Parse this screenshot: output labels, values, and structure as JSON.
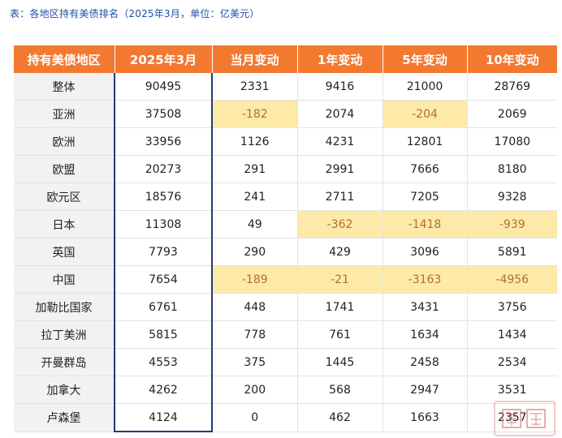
{
  "caption": "表：各地区持有美债排名（2025年3月，单位：亿美元）",
  "table": {
    "headers": [
      "持有美债地区",
      "2025年3月",
      "当月变动",
      "1年变动",
      "5年变动",
      "10年变动"
    ],
    "rows": [
      [
        "整体",
        "90495",
        "2331",
        "9416",
        "21000",
        "28769"
      ],
      [
        "亚洲",
        "37508",
        "-182",
        "2074",
        "-204",
        "2069"
      ],
      [
        "欧洲",
        "33956",
        "1126",
        "4231",
        "12801",
        "17080"
      ],
      [
        "欧盟",
        "20273",
        "291",
        "2991",
        "7666",
        "8180"
      ],
      [
        "欧元区",
        "18576",
        "241",
        "2711",
        "7205",
        "9328"
      ],
      [
        "日本",
        "11308",
        "49",
        "-362",
        "-1418",
        "-939"
      ],
      [
        "英国",
        "7793",
        "290",
        "429",
        "3096",
        "5891"
      ],
      [
        "中国",
        "7654",
        "-189",
        "-21",
        "-3163",
        "-4956"
      ],
      [
        "加勒比国家",
        "6761",
        "448",
        "1741",
        "3431",
        "3756"
      ],
      [
        "拉丁美洲",
        "5815",
        "778",
        "761",
        "1634",
        "1434"
      ],
      [
        "开曼群岛",
        "4553",
        "375",
        "1445",
        "2458",
        "2534"
      ],
      [
        "加拿大",
        "4262",
        "200",
        "568",
        "2947",
        "3531"
      ],
      [
        "卢森堡",
        "4124",
        "0",
        "462",
        "1663",
        "2357"
      ]
    ]
  },
  "colors": {
    "header_bg": "#f47930",
    "negative_highlight": "#fde9a8",
    "current_column_border": "#1f3d7a",
    "caption_text": "#1f4fa3"
  },
  "icons": {
    "watermark": "stamp-watermark"
  }
}
